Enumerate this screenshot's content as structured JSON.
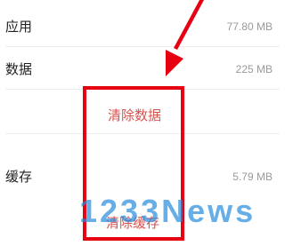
{
  "storage": {
    "app_label": "应用",
    "app_value": "77.80 MB",
    "data_label": "数据",
    "data_value": "225 MB",
    "cache_label": "缓存",
    "cache_value": "5.79 MB"
  },
  "actions": {
    "clear_data": "清除数据",
    "clear_cache": "清除缓存"
  },
  "watermark": {
    "text": "1233News"
  },
  "colors": {
    "annotation_red": "#e60012",
    "action_red": "#d9534f",
    "watermark_blue": "#288cdc"
  }
}
